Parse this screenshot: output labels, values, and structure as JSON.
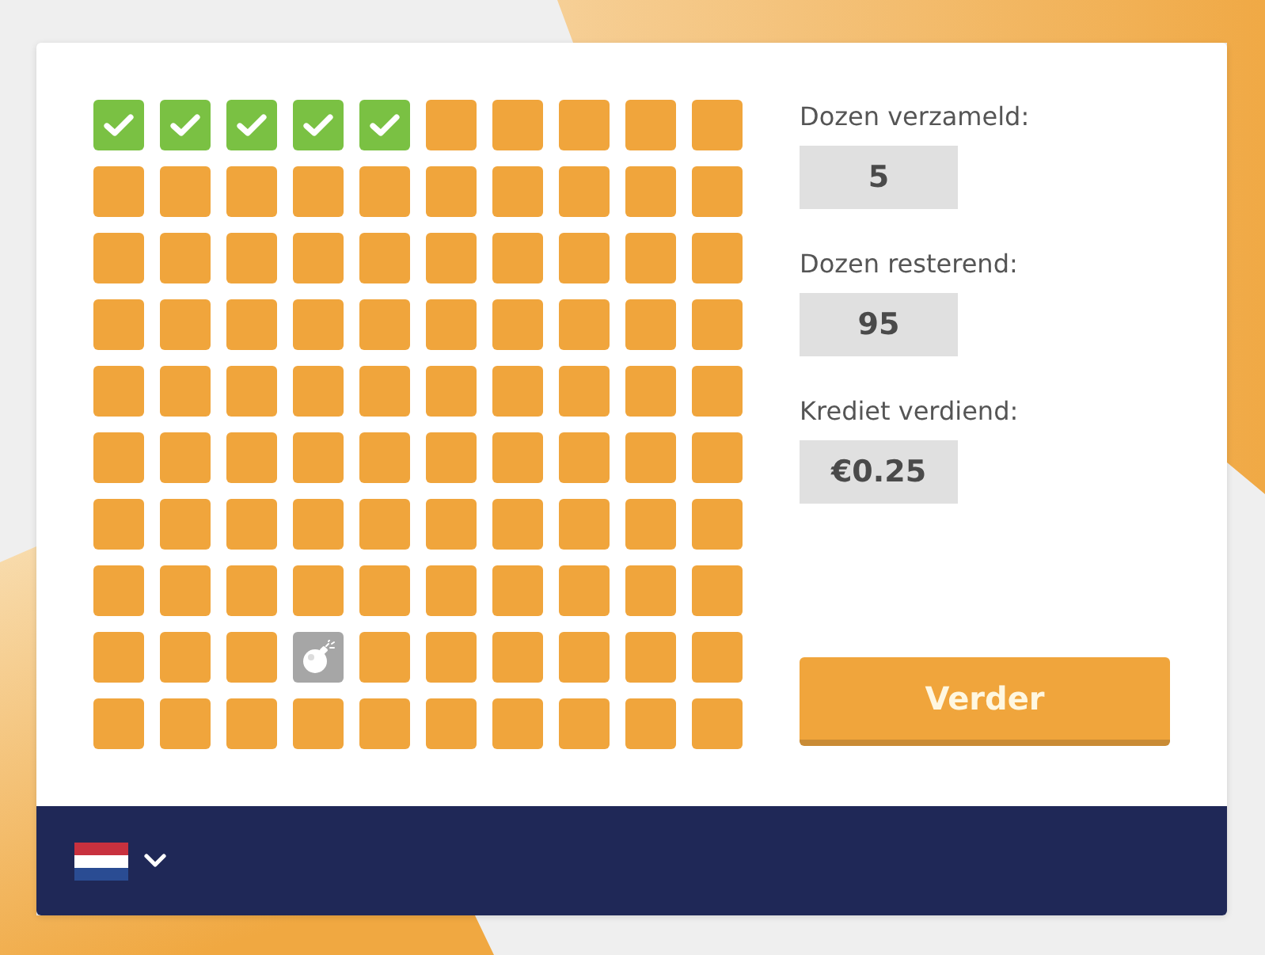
{
  "grid": {
    "boxes": [
      {
        "kind": "collected"
      },
      {
        "kind": "collected"
      },
      {
        "kind": "collected"
      },
      {
        "kind": "collected"
      },
      {
        "kind": "collected"
      },
      {
        "kind": "closed"
      },
      {
        "kind": "closed"
      },
      {
        "kind": "closed"
      },
      {
        "kind": "closed"
      },
      {
        "kind": "closed"
      },
      {
        "kind": "closed"
      },
      {
        "kind": "closed"
      },
      {
        "kind": "closed"
      },
      {
        "kind": "closed"
      },
      {
        "kind": "closed"
      },
      {
        "kind": "closed"
      },
      {
        "kind": "closed"
      },
      {
        "kind": "closed"
      },
      {
        "kind": "closed"
      },
      {
        "kind": "closed"
      },
      {
        "kind": "closed"
      },
      {
        "kind": "closed"
      },
      {
        "kind": "closed"
      },
      {
        "kind": "closed"
      },
      {
        "kind": "closed"
      },
      {
        "kind": "closed"
      },
      {
        "kind": "closed"
      },
      {
        "kind": "closed"
      },
      {
        "kind": "closed"
      },
      {
        "kind": "closed"
      },
      {
        "kind": "closed"
      },
      {
        "kind": "closed"
      },
      {
        "kind": "closed"
      },
      {
        "kind": "closed"
      },
      {
        "kind": "closed"
      },
      {
        "kind": "closed"
      },
      {
        "kind": "closed"
      },
      {
        "kind": "closed"
      },
      {
        "kind": "closed"
      },
      {
        "kind": "closed"
      },
      {
        "kind": "closed"
      },
      {
        "kind": "closed"
      },
      {
        "kind": "closed"
      },
      {
        "kind": "closed"
      },
      {
        "kind": "closed"
      },
      {
        "kind": "closed"
      },
      {
        "kind": "closed"
      },
      {
        "kind": "closed"
      },
      {
        "kind": "closed"
      },
      {
        "kind": "closed"
      },
      {
        "kind": "closed"
      },
      {
        "kind": "closed"
      },
      {
        "kind": "closed"
      },
      {
        "kind": "closed"
      },
      {
        "kind": "closed"
      },
      {
        "kind": "closed"
      },
      {
        "kind": "closed"
      },
      {
        "kind": "closed"
      },
      {
        "kind": "closed"
      },
      {
        "kind": "closed"
      },
      {
        "kind": "closed"
      },
      {
        "kind": "closed"
      },
      {
        "kind": "closed"
      },
      {
        "kind": "closed"
      },
      {
        "kind": "closed"
      },
      {
        "kind": "closed"
      },
      {
        "kind": "closed"
      },
      {
        "kind": "closed"
      },
      {
        "kind": "closed"
      },
      {
        "kind": "closed"
      },
      {
        "kind": "closed"
      },
      {
        "kind": "closed"
      },
      {
        "kind": "closed"
      },
      {
        "kind": "closed"
      },
      {
        "kind": "closed"
      },
      {
        "kind": "closed"
      },
      {
        "kind": "closed"
      },
      {
        "kind": "closed"
      },
      {
        "kind": "closed"
      },
      {
        "kind": "closed"
      },
      {
        "kind": "closed"
      },
      {
        "kind": "closed"
      },
      {
        "kind": "closed"
      },
      {
        "kind": "bomb"
      },
      {
        "kind": "closed"
      },
      {
        "kind": "closed"
      },
      {
        "kind": "closed"
      },
      {
        "kind": "closed"
      },
      {
        "kind": "closed"
      },
      {
        "kind": "closed"
      },
      {
        "kind": "closed"
      },
      {
        "kind": "closed"
      },
      {
        "kind": "closed"
      },
      {
        "kind": "closed"
      },
      {
        "kind": "closed"
      },
      {
        "kind": "closed"
      },
      {
        "kind": "closed"
      },
      {
        "kind": "closed"
      },
      {
        "kind": "closed"
      },
      {
        "kind": "closed"
      }
    ]
  },
  "stats": [
    {
      "label": "Dozen verzameld:",
      "value": "5"
    },
    {
      "label": "Dozen resterend:",
      "value": "95"
    },
    {
      "label": "Krediet verdiend:",
      "value": "€0.25"
    }
  ],
  "continue_button": {
    "label": "Verder"
  }
}
